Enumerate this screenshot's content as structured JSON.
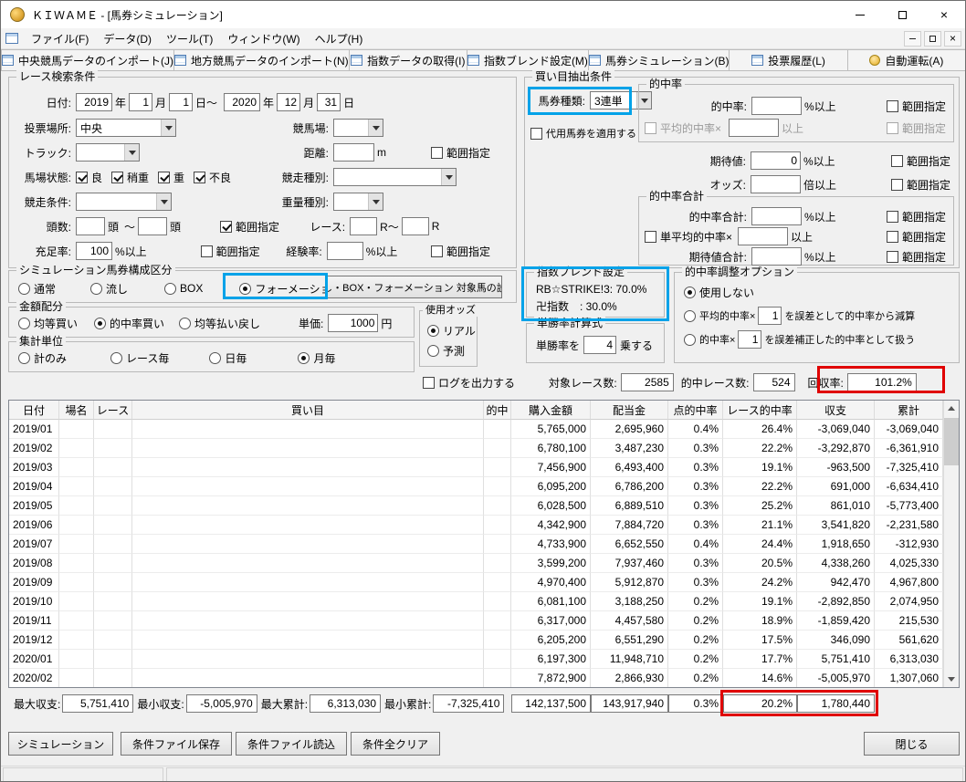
{
  "window": {
    "title": "ＫＩＷＡＭＥ - [馬券シミュレーション]"
  },
  "menu": [
    "ファイル(F)",
    "データ(D)",
    "ツール(T)",
    "ウィンドウ(W)",
    "ヘルプ(H)"
  ],
  "toolbar": [
    "中央競馬データのインポート(J)",
    "地方競馬データのインポート(N)",
    "指数データの取得(I)",
    "指数ブレンド設定(M)",
    "馬券シミュレーション(B)",
    "投票履歴(L)",
    "自動運転(A)"
  ],
  "units": {
    "year": "年",
    "month": "月",
    "day_tilde": "日～",
    "day": "日",
    "m": "m",
    "head": "頭",
    "tilde": "～",
    "r_tilde": "R～",
    "r": "R",
    "pct_up": "%以上",
    "odds_up": "倍以上",
    "up": "以上",
    "yen": "円",
    "range": "範囲指定"
  },
  "search": {
    "title": "レース検索条件",
    "date": {
      "label": "日付:",
      "from_year": "2019",
      "from_month": "1",
      "from_day": "1",
      "to_year": "2020",
      "to_month": "12",
      "to_day": "31"
    },
    "place": {
      "label": "投票場所:",
      "value": "中央"
    },
    "course": {
      "label": "競馬場:",
      "value": ""
    },
    "track": {
      "label": "トラック:",
      "value": ""
    },
    "distance": {
      "label": "距離:",
      "value": ""
    },
    "ground": {
      "label": "馬場状態:",
      "options": [
        "良",
        "稍重",
        "重",
        "不良"
      ]
    },
    "race_kind": {
      "label": "競走種別:",
      "value": ""
    },
    "race_cond": {
      "label": "競走条件:",
      "value": ""
    },
    "weight": {
      "label": "重量種別:",
      "value": ""
    },
    "heads": {
      "label": "頭数:"
    },
    "race_no": {
      "label": "レース:"
    },
    "fill": {
      "label": "充足率:",
      "value": "100"
    },
    "exp": {
      "label": "経験率:",
      "value": ""
    }
  },
  "extract": {
    "title": "買い目抽出条件",
    "ticket": {
      "label": "馬券種類:",
      "value": "3連単"
    },
    "substitute": "代用馬券を適用する",
    "hit": {
      "title": "的中率",
      "row1": {
        "label": "的中率:"
      },
      "row2": {
        "label": "平均的中率×"
      }
    },
    "expect": {
      "label": "期待値:",
      "value": "0"
    },
    "odds": {
      "label": "オッズ:",
      "value": ""
    },
    "hit_total": {
      "title": "的中率合計",
      "row1": {
        "label": "的中率合計:"
      },
      "row2": {
        "label": "単平均的中率×"
      },
      "row3": {
        "label": "期待値合計:"
      }
    }
  },
  "sim_type": {
    "title": "シミュレーション馬券構成区分",
    "options": [
      "通常",
      "流し",
      "BOX",
      "フォーメーション"
    ],
    "selected": 3,
    "setting_button": "流し・BOX・フォーメーション 対象馬の設定"
  },
  "amount": {
    "title": "金額配分",
    "options": [
      "均等買い",
      "的中率買い",
      "均等払い戻し"
    ],
    "selected": 1,
    "unit_label": "単価:",
    "unit_value": "1000"
  },
  "aggregate": {
    "title": "集計単位",
    "options": [
      "計のみ",
      "レース毎",
      "日毎",
      "月毎"
    ],
    "selected": 3
  },
  "odds_src": {
    "title": "使用オッズ",
    "options": [
      "リアル",
      "予測"
    ],
    "selected": 0
  },
  "log_checkbox": "ログを出力する",
  "blend": {
    "title": "指数ブレンド設定",
    "line1": "RB☆STRIKE!3: 70.0%",
    "line2": "卍指数　: 30.0%"
  },
  "win_formula": {
    "title": "単勝率計算式",
    "pre": "単勝率を",
    "value": "4",
    "post": "乗する"
  },
  "adjust": {
    "title": "的中率調整オプション",
    "opt1": "使用しない",
    "opt2_pre": "平均的中率×",
    "opt2_val": "1",
    "opt2_post": "を誤差として的中率から減算",
    "opt3_pre": "的中率×",
    "opt3_val": "1",
    "opt3_post": "を誤差補正した的中率として扱う"
  },
  "stats": {
    "target_label": "対象レース数:",
    "target": "2585",
    "hit_label": "的中レース数:",
    "hit": "524",
    "recovery_label": "回収率:",
    "recovery": "101.2%"
  },
  "table": {
    "columns": [
      "日付",
      "場名",
      "レース",
      "買い目",
      "的中",
      "購入金額",
      "配当金",
      "点的中率",
      "レース的中率",
      "収支",
      "累計"
    ],
    "rows": [
      {
        "date": "2019/01",
        "purchase": "5,765,000",
        "payout": "2,695,960",
        "point_rate": "0.4%",
        "race_rate": "26.4%",
        "balance": "-3,069,040",
        "total": "-3,069,040"
      },
      {
        "date": "2019/02",
        "purchase": "6,780,100",
        "payout": "3,487,230",
        "point_rate": "0.3%",
        "race_rate": "22.2%",
        "balance": "-3,292,870",
        "total": "-6,361,910"
      },
      {
        "date": "2019/03",
        "purchase": "7,456,900",
        "payout": "6,493,400",
        "point_rate": "0.3%",
        "race_rate": "19.1%",
        "balance": "-963,500",
        "total": "-7,325,410"
      },
      {
        "date": "2019/04",
        "purchase": "6,095,200",
        "payout": "6,786,200",
        "point_rate": "0.3%",
        "race_rate": "22.2%",
        "balance": "691,000",
        "total": "-6,634,410"
      },
      {
        "date": "2019/05",
        "purchase": "6,028,500",
        "payout": "6,889,510",
        "point_rate": "0.3%",
        "race_rate": "25.2%",
        "balance": "861,010",
        "total": "-5,773,400"
      },
      {
        "date": "2019/06",
        "purchase": "4,342,900",
        "payout": "7,884,720",
        "point_rate": "0.3%",
        "race_rate": "21.1%",
        "balance": "3,541,820",
        "total": "-2,231,580"
      },
      {
        "date": "2019/07",
        "purchase": "4,733,900",
        "payout": "6,652,550",
        "point_rate": "0.4%",
        "race_rate": "24.4%",
        "balance": "1,918,650",
        "total": "-312,930"
      },
      {
        "date": "2019/08",
        "purchase": "3,599,200",
        "payout": "7,937,460",
        "point_rate": "0.3%",
        "race_rate": "20.5%",
        "balance": "4,338,260",
        "total": "4,025,330"
      },
      {
        "date": "2019/09",
        "purchase": "4,970,400",
        "payout": "5,912,870",
        "point_rate": "0.3%",
        "race_rate": "24.2%",
        "balance": "942,470",
        "total": "4,967,800"
      },
      {
        "date": "2019/10",
        "purchase": "6,081,100",
        "payout": "3,188,250",
        "point_rate": "0.2%",
        "race_rate": "19.1%",
        "balance": "-2,892,850",
        "total": "2,074,950"
      },
      {
        "date": "2019/11",
        "purchase": "6,317,000",
        "payout": "4,457,580",
        "point_rate": "0.2%",
        "race_rate": "18.9%",
        "balance": "-1,859,420",
        "total": "215,530"
      },
      {
        "date": "2019/12",
        "purchase": "6,205,200",
        "payout": "6,551,290",
        "point_rate": "0.2%",
        "race_rate": "17.5%",
        "balance": "346,090",
        "total": "561,620"
      },
      {
        "date": "2020/01",
        "purchase": "6,197,300",
        "payout": "11,948,710",
        "point_rate": "0.2%",
        "race_rate": "17.7%",
        "balance": "5,751,410",
        "total": "6,313,030"
      },
      {
        "date": "2020/02",
        "purchase": "7,872,900",
        "payout": "2,866,930",
        "point_rate": "0.2%",
        "race_rate": "14.6%",
        "balance": "-5,005,970",
        "total": "1,307,060"
      }
    ]
  },
  "summary": {
    "max_balance_label": "最大収支:",
    "max_balance": "5,751,410",
    "min_balance_label": "最小収支:",
    "min_balance": "-5,005,970",
    "max_total_label": "最大累計:",
    "max_total": "6,313,030",
    "min_total_label": "最小累計:",
    "min_total": "-7,325,410",
    "purchase_total": "142,137,500",
    "payout_total": "143,917,940",
    "point_rate_total": "0.3%",
    "race_rate_total": "20.2%",
    "balance_total": "1,780,440"
  },
  "footer": {
    "buttons": [
      "シミュレーション",
      "条件ファイル保存",
      "条件ファイル読込",
      "条件全クリア"
    ],
    "close": "閉じる"
  }
}
